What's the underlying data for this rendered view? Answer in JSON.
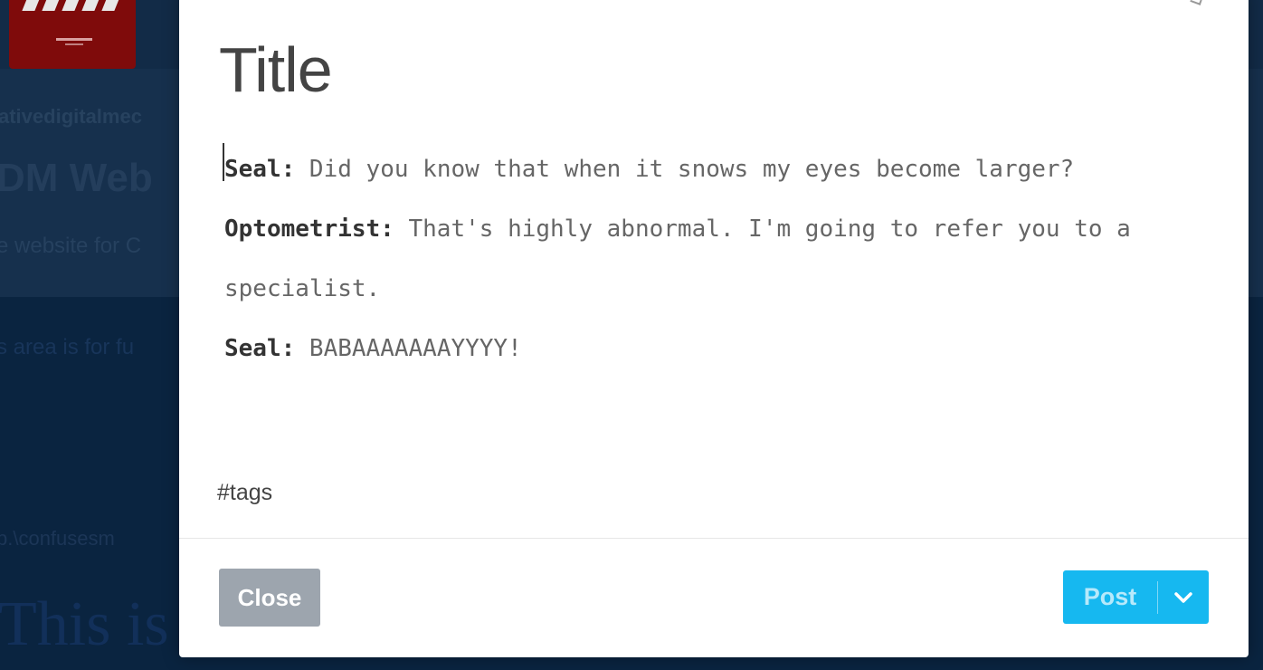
{
  "background": {
    "blog_name": "ativedigitalmec",
    "blog_title": "DM Web",
    "blog_description": "e website for C",
    "info_text": "s area is for fu",
    "url_text": "b.\\confusesm",
    "big_heading": "This is",
    "logo_color": "#7f0b0b",
    "page_color": "#0a2440"
  },
  "modal": {
    "title": "Title",
    "body": [
      {
        "speaker": "Seal:",
        "text": " Did you know that when it snows my eyes become larger?"
      },
      {
        "speaker": "Optometrist:",
        "text": " That's highly abnormal. I'm going to refer you to a specialist."
      },
      {
        "speaker": "Seal:",
        "text": " BABAAAAAAAYYYY!"
      }
    ],
    "tags": "#tags",
    "close_label": "Close",
    "post_label": "Post",
    "post_color": "#16b8f0",
    "close_color": "#9da5ae",
    "chevron_icon": "chevron-down-icon"
  }
}
